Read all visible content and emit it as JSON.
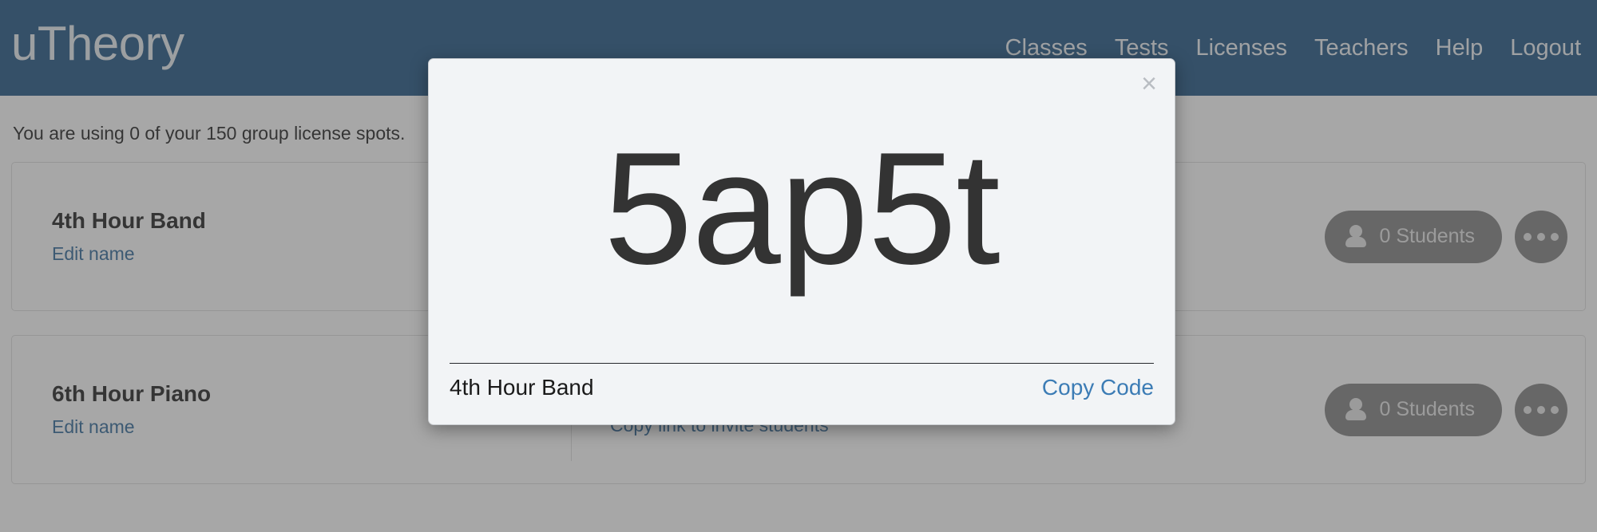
{
  "header": {
    "brand": "uTheory",
    "nav": [
      {
        "label": "Classes",
        "name": "nav-classes"
      },
      {
        "label": "Tests",
        "name": "nav-tests"
      },
      {
        "label": "Licenses",
        "name": "nav-licenses"
      },
      {
        "label": "Teachers",
        "name": "nav-teachers"
      },
      {
        "label": "Help",
        "name": "nav-help"
      },
      {
        "label": "Logout",
        "name": "nav-logout"
      }
    ],
    "background_color": "#1b5180"
  },
  "main": {
    "license_status": "You are using 0 of your 150 group license spots.",
    "classes": [
      {
        "title": "4th Hour Band",
        "edit_label": "Edit name",
        "section_url": "",
        "copy_link_label": "",
        "students_label": "0 Students",
        "more_label": "•••"
      },
      {
        "title": "6th Hour Piano",
        "edit_label": "Edit name",
        "section_url": "https://utheory.com/section/5rn2t",
        "copy_link_label": "Copy link to invite students",
        "students_label": "0 Students",
        "more_label": "•••"
      }
    ]
  },
  "modal": {
    "close_label": "×",
    "join_code": "5ap5t",
    "class_name": "4th Hour Band",
    "copy_code_label": "Copy Code",
    "link_color": "#3c7cb5"
  }
}
